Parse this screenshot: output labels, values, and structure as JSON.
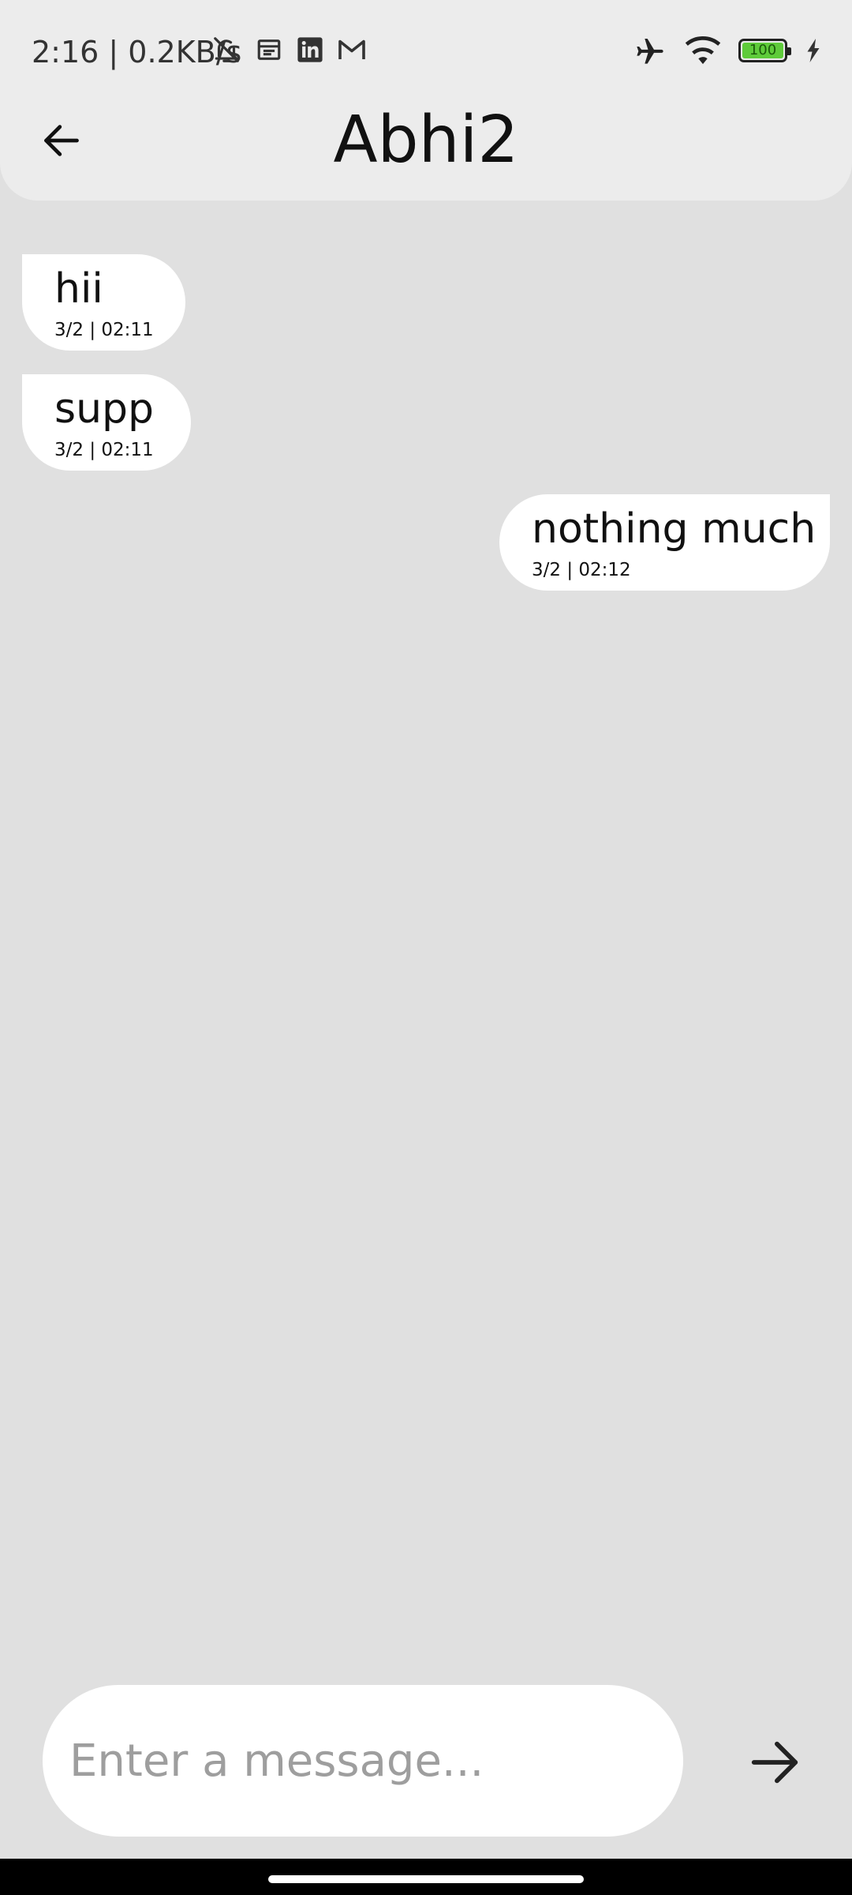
{
  "status_bar": {
    "time_text": "2:16 | 0.2KB/s",
    "battery_level": "100",
    "icons_left": [
      "bell-off-icon",
      "calendar-icon",
      "linkedin-icon",
      "gmail-icon"
    ],
    "icons_right": [
      "airplane-icon",
      "wifi-icon",
      "battery-icon",
      "charging-bolt-icon"
    ],
    "battery_color": "#5ecb3a"
  },
  "header": {
    "title": "Abhi2",
    "back_icon": "arrow-left-icon",
    "background": "#ececec"
  },
  "messages": [
    {
      "side": "left",
      "text": "hii",
      "time": "3/2 | 02:11"
    },
    {
      "side": "left",
      "text": "supp",
      "time": "3/2 | 02:11"
    },
    {
      "side": "right",
      "text": "nothing much",
      "time": "3/2 | 02:12"
    }
  ],
  "composer": {
    "placeholder": "Enter a message...",
    "value": "",
    "send_icon": "arrow-right-icon"
  },
  "colors": {
    "chat_background": "#e0e0e0",
    "bubble": "#ffffff",
    "placeholder": "#9e9e9e"
  }
}
